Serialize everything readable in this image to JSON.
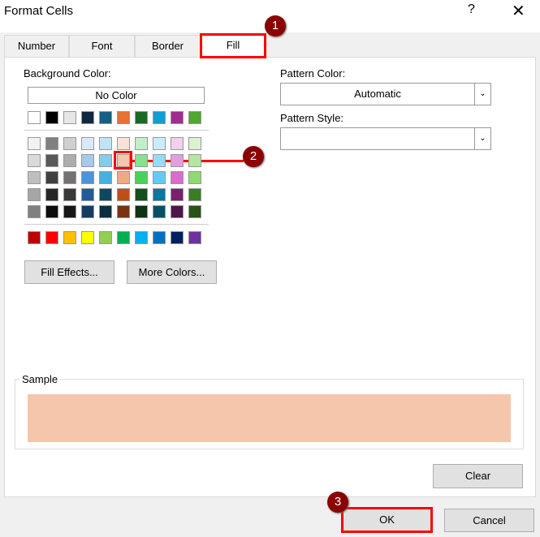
{
  "window": {
    "title": "Format Cells",
    "help": "?",
    "close": "✕"
  },
  "tabs": [
    {
      "label": "Number"
    },
    {
      "label": "Font"
    },
    {
      "label": "Border"
    },
    {
      "label": "Fill",
      "active": true
    }
  ],
  "fill": {
    "background_color_label": "Background Color:",
    "no_color": "No Color",
    "theme_row": [
      "#FFFFFF",
      "#000000",
      "#E7E6E6",
      "#0E2841",
      "#156082",
      "#E97132",
      "#196B24",
      "#0F9ED5",
      "#A02B93",
      "#4EA72E"
    ],
    "tint_rows": [
      [
        "#F2F2F2",
        "#808080",
        "#D0D0D0",
        "#DAE9F8",
        "#C1E4F5",
        "#FBE2D5",
        "#C1F0C8",
        "#CAEDFB",
        "#F2CEEF",
        "#DAF2D0"
      ],
      [
        "#D9D9D9",
        "#595959",
        "#ADADAD",
        "#A6C9EC",
        "#83CCEB",
        "#F7C7AC",
        "#84E291",
        "#94DCF8",
        "#E59EDD",
        "#B5E6A2"
      ],
      [
        "#BFBFBF",
        "#404040",
        "#757171",
        "#4D93D9",
        "#45B0E1",
        "#F1A983",
        "#47D359",
        "#61CBF3",
        "#D86DCD",
        "#8ED973"
      ],
      [
        "#A6A6A6",
        "#262626",
        "#3A3838",
        "#215C98",
        "#0F4761",
        "#C04F15",
        "#124F1A",
        "#0B76A0",
        "#78206E",
        "#3B7D23"
      ],
      [
        "#808080",
        "#0D0D0D",
        "#171717",
        "#153D64",
        "#0A2F41",
        "#7A3210",
        "#0C3511",
        "#074F69",
        "#501549",
        "#275317"
      ]
    ],
    "standard_row": [
      "#C00000",
      "#FF0000",
      "#FFC000",
      "#FFFF00",
      "#92D050",
      "#00B050",
      "#00B0F0",
      "#0070C0",
      "#002060",
      "#7030A0"
    ],
    "selected": {
      "row": 1,
      "col": 5
    },
    "fill_effects": "Fill Effects...",
    "more_colors": "More Colors...",
    "pattern_color_label": "Pattern Color:",
    "pattern_color_value": "Automatic",
    "pattern_style_label": "Pattern Style:",
    "pattern_style_value": "",
    "sample_label": "Sample",
    "sample_color": "#F5C6AC",
    "clear": "Clear"
  },
  "buttons": {
    "ok": "OK",
    "cancel": "Cancel"
  },
  "annotations": {
    "b1": "1",
    "b2": "2",
    "b3": "3"
  }
}
